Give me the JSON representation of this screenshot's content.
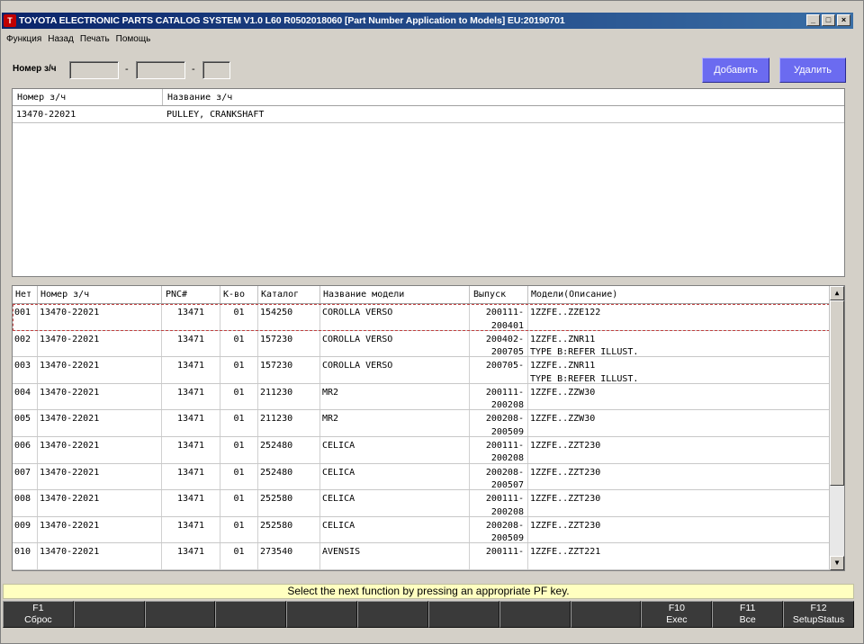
{
  "window": {
    "title": "TOYOTA ELECTRONIC PARTS CATALOG SYSTEM V1.0 L60 R0502018060 [Part Number Application to Models] EU:20190701",
    "buttons": {
      "minimize": "_",
      "maximize": "□",
      "close": "×"
    }
  },
  "menu": [
    "Функция",
    "Назад",
    "Печать",
    "Помощь"
  ],
  "search": {
    "label": "Номер з/ч",
    "part1": "",
    "part2": "",
    "part3": "",
    "separator": "-",
    "add_label": "Добавить",
    "delete_label": "Удалить"
  },
  "parts_table": {
    "headers": [
      "Номер з/ч",
      "Название з/ч"
    ],
    "rows": [
      {
        "part_no": "13470-22021",
        "name": "PULLEY, CRANKSHAFT"
      }
    ]
  },
  "models_table": {
    "headers": [
      "Нет",
      "Номер з/ч",
      "PNC#",
      "К-во",
      "Каталог",
      "Название модели",
      "Выпуск",
      "Модели(Описание)"
    ],
    "rows": [
      {
        "n": "001",
        "part": "13470-22021",
        "pnc": "13471",
        "qty": "01",
        "cat": "154250",
        "model": "COROLLA VERSO",
        "release": "200111-\n200401",
        "desc": "1ZZFE..ZZE122"
      },
      {
        "n": "002",
        "part": "13470-22021",
        "pnc": "13471",
        "qty": "01",
        "cat": "157230",
        "model": "COROLLA VERSO",
        "release": "200402-\n200705",
        "desc": "1ZZFE..ZNR11\nTYPE B:REFER ILLUST."
      },
      {
        "n": "003",
        "part": "13470-22021",
        "pnc": "13471",
        "qty": "01",
        "cat": "157230",
        "model": "COROLLA VERSO",
        "release": "200705-",
        "desc": "1ZZFE..ZNR11\nTYPE B:REFER ILLUST."
      },
      {
        "n": "004",
        "part": "13470-22021",
        "pnc": "13471",
        "qty": "01",
        "cat": "211230",
        "model": "MR2",
        "release": "200111-\n200208",
        "desc": "1ZZFE..ZZW30"
      },
      {
        "n": "005",
        "part": "13470-22021",
        "pnc": "13471",
        "qty": "01",
        "cat": "211230",
        "model": "MR2",
        "release": "200208-\n200509",
        "desc": "1ZZFE..ZZW30"
      },
      {
        "n": "006",
        "part": "13470-22021",
        "pnc": "13471",
        "qty": "01",
        "cat": "252480",
        "model": "CELICA",
        "release": "200111-\n200208",
        "desc": "1ZZFE..ZZT230"
      },
      {
        "n": "007",
        "part": "13470-22021",
        "pnc": "13471",
        "qty": "01",
        "cat": "252480",
        "model": "CELICA",
        "release": "200208-\n200507",
        "desc": "1ZZFE..ZZT230"
      },
      {
        "n": "008",
        "part": "13470-22021",
        "pnc": "13471",
        "qty": "01",
        "cat": "252580",
        "model": "CELICA",
        "release": "200111-\n200208",
        "desc": "1ZZFE..ZZT230"
      },
      {
        "n": "009",
        "part": "13470-22021",
        "pnc": "13471",
        "qty": "01",
        "cat": "252580",
        "model": "CELICA",
        "release": "200208-\n200509",
        "desc": "1ZZFE..ZZT230"
      },
      {
        "n": "010",
        "part": "13470-22021",
        "pnc": "13471",
        "qty": "01",
        "cat": "273540",
        "model": "AVENSIS",
        "release": "200111-",
        "desc": "1ZZFE..ZZT221"
      }
    ]
  },
  "status": "Select the next function by pressing an appropriate PF key.",
  "fkeys": [
    {
      "num": "F1",
      "label": "Сброс"
    },
    {
      "num": "",
      "label": ""
    },
    {
      "num": "",
      "label": ""
    },
    {
      "num": "",
      "label": ""
    },
    {
      "num": "",
      "label": ""
    },
    {
      "num": "",
      "label": ""
    },
    {
      "num": "",
      "label": ""
    },
    {
      "num": "",
      "label": ""
    },
    {
      "num": "",
      "label": ""
    },
    {
      "num": "F10",
      "label": "Exec"
    },
    {
      "num": "F11",
      "label": "Все"
    },
    {
      "num": "F12",
      "label": "SetupStatus"
    }
  ],
  "colors": {
    "titlebar": "#0a246a",
    "action_button": "#6b6bf0",
    "status_bg": "#ffffc0",
    "fkey_bg": "#3a3a3a",
    "selected_row_outline": "#c04040"
  },
  "icons": {
    "app": "toyota-logo-icon",
    "scroll_up": "arrow-up-icon",
    "scroll_down": "arrow-down-icon"
  }
}
